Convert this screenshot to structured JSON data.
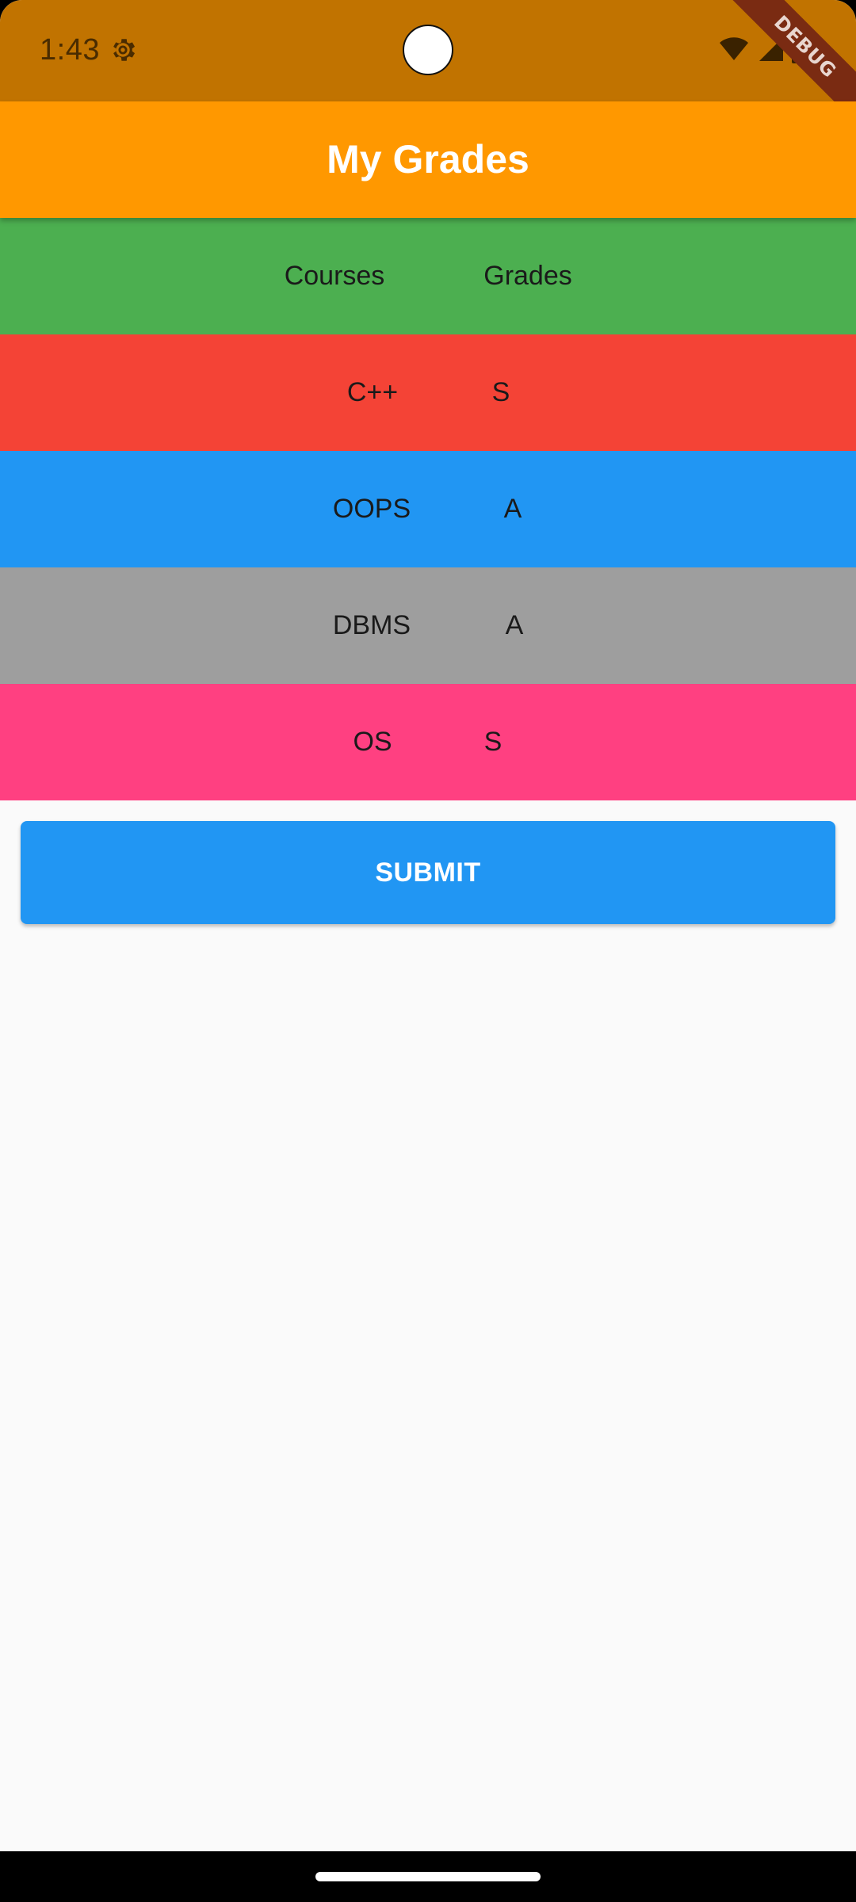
{
  "status_bar": {
    "time": "1:43",
    "background": "#c17300",
    "icons": [
      "gear-icon",
      "wifi-icon",
      "signal-icon",
      "battery-icon"
    ]
  },
  "debug_banner": {
    "label": "DEBUG"
  },
  "app_bar": {
    "title": "My Grades",
    "background": "#ff9800"
  },
  "table": {
    "header": {
      "course": "Courses",
      "grade": "Grades",
      "color": "#4caf50"
    },
    "rows": [
      {
        "course": "C++",
        "grade": "S",
        "color": "#f44336"
      },
      {
        "course": "OOPS",
        "grade": "A",
        "color": "#2196f3"
      },
      {
        "course": "DBMS",
        "grade": "A",
        "color": "#9e9e9e"
      },
      {
        "course": "OS",
        "grade": "S",
        "color": "#ff4081"
      }
    ]
  },
  "submit_button": {
    "label": "SUBMIT",
    "color": "#2196f3"
  }
}
